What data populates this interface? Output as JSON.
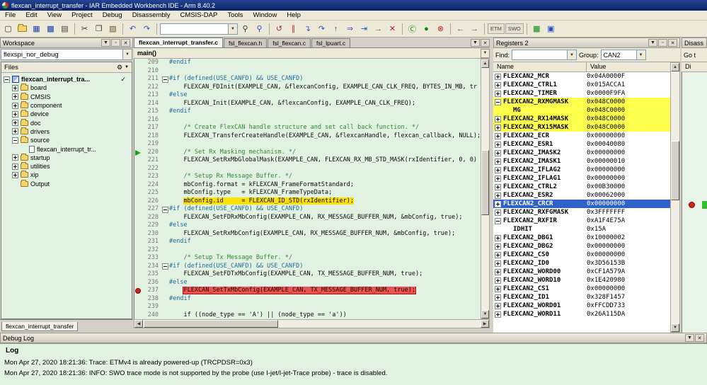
{
  "window": {
    "title": "flexcan_interrupt_transfer - IAR Embedded Workbench IDE - Arm 8.40.2"
  },
  "glyphs": {
    "menu_btn": "▼",
    "pin_btn": "▫",
    "close_btn": "✕",
    "dropdown": "▼",
    "up": "▲",
    "down": "▼",
    "left": "◀",
    "right": "▶",
    "gear": "⚙",
    "check": "✓"
  },
  "menu": {
    "items": [
      "File",
      "Edit",
      "View",
      "Project",
      "Debug",
      "Disassembly",
      "CMSIS-DAP",
      "Tools",
      "Window",
      "Help"
    ]
  },
  "toolbar": {
    "items": [
      {
        "type": "icon",
        "name": "new-document-icon",
        "glyph": "▢",
        "color": "#303030"
      },
      {
        "type": "folder",
        "name": "open-file-icon"
      },
      {
        "type": "icon",
        "name": "save-icon",
        "glyph": "▦",
        "color": "#1c3faa"
      },
      {
        "type": "icon",
        "name": "save-all-icon",
        "glyph": "▩",
        "color": "#1c3faa"
      },
      {
        "type": "icon",
        "name": "print-icon",
        "glyph": "▤",
        "color": "#404040"
      },
      {
        "type": "sep"
      },
      {
        "type": "icon",
        "name": "cut-icon",
        "glyph": "✂",
        "color": "#303030"
      },
      {
        "type": "icon",
        "name": "copy-icon",
        "glyph": "❐",
        "color": "#303030"
      },
      {
        "type": "icon",
        "name": "paste-icon",
        "glyph": "▨",
        "color": "#705020"
      },
      {
        "type": "sep"
      },
      {
        "type": "icon",
        "name": "undo-icon",
        "glyph": "↶",
        "color": "#2a4fbf"
      },
      {
        "type": "icon",
        "name": "redo-icon",
        "glyph": "↷",
        "color": "#2a4fbf"
      },
      {
        "type": "sep"
      },
      {
        "type": "combo",
        "name": "quick-search-combo"
      },
      {
        "type": "icon",
        "name": "find-icon",
        "glyph": "⚲",
        "color": "#303030"
      },
      {
        "type": "icon",
        "name": "find-next-icon",
        "glyph": "⚲",
        "color": "#2a4fbf"
      },
      {
        "type": "sep"
      },
      {
        "type": "icon",
        "name": "reset-icon",
        "glyph": "↺",
        "color": "#a03030"
      },
      {
        "type": "icon",
        "name": "break-icon",
        "glyph": "∥",
        "color": "#a03030"
      },
      {
        "type": "icon",
        "name": "step-into-icon",
        "glyph": "↴",
        "color": "#2a4fbf"
      },
      {
        "type": "icon",
        "name": "step-over-icon",
        "glyph": "↷",
        "color": "#2a4fbf"
      },
      {
        "type": "icon",
        "name": "step-out-icon",
        "glyph": "↑",
        "color": "#2a4fbf"
      },
      {
        "type": "icon",
        "name": "next-statement-icon",
        "glyph": "⇒",
        "color": "#2a4fbf"
      },
      {
        "type": "icon",
        "name": "run-to-cursor-icon",
        "glyph": "⇥",
        "color": "#2a4fbf"
      },
      {
        "type": "icon",
        "name": "go-icon",
        "glyph": "→",
        "color": "#0a8a0a"
      },
      {
        "type": "icon",
        "name": "stop-debug-icon",
        "glyph": "✕",
        "color": "#c02020"
      },
      {
        "type": "sep"
      },
      {
        "type": "icon",
        "name": "probe-connect-icon",
        "glyph": "Ⓒ",
        "color": "#0a8a0a"
      },
      {
        "type": "icon",
        "name": "probe-active-icon",
        "glyph": "●",
        "color": "#0a8a0a"
      },
      {
        "type": "icon",
        "name": "probe-disconnect-icon",
        "glyph": "⊗",
        "color": "#c02020"
      },
      {
        "type": "sep"
      },
      {
        "type": "icon",
        "name": "nav-back-icon",
        "glyph": "←",
        "color": "#2a4fbf"
      },
      {
        "type": "icon",
        "name": "nav-forward-icon",
        "glyph": "→",
        "color": "#2a4fbf"
      },
      {
        "type": "sep"
      },
      {
        "type": "text",
        "name": "etm-button",
        "label": "ETM"
      },
      {
        "type": "text",
        "name": "swo-button",
        "label": "SWO"
      },
      {
        "type": "sep"
      },
      {
        "type": "icon",
        "name": "trace-icon",
        "glyph": "▦",
        "color": "#0a8a0a"
      },
      {
        "type": "icon",
        "name": "terminal-io-icon",
        "glyph": "▣",
        "color": "#2a4fbf"
      }
    ]
  },
  "workspace": {
    "title": "Workspace",
    "config": "flexspi_nor_debug",
    "files_header": "Files",
    "bottom_tab": "flexcan_interrupt_transfer",
    "tree": [
      {
        "label": "flexcan_interrupt_tra...",
        "level": 0,
        "icon": "project",
        "exp": "minus",
        "bold": true,
        "check": true
      },
      {
        "label": "board",
        "level": 1,
        "icon": "folder",
        "exp": "plus"
      },
      {
        "label": "CMSIS",
        "level": 1,
        "icon": "folder",
        "exp": "plus"
      },
      {
        "label": "component",
        "level": 1,
        "icon": "folder",
        "exp": "plus"
      },
      {
        "label": "device",
        "level": 1,
        "icon": "folder",
        "exp": "plus"
      },
      {
        "label": "doc",
        "level": 1,
        "icon": "folder",
        "exp": "plus"
      },
      {
        "label": "drivers",
        "level": 1,
        "icon": "folder",
        "exp": "plus"
      },
      {
        "label": "source",
        "level": 1,
        "icon": "folder",
        "exp": "minus"
      },
      {
        "label": "flexcan_interrupt_tr...",
        "level": 2,
        "icon": "file",
        "exp": null
      },
      {
        "label": "startup",
        "level": 1,
        "icon": "folder",
        "exp": "plus"
      },
      {
        "label": "utilities",
        "level": 1,
        "icon": "folder",
        "exp": "plus"
      },
      {
        "label": "xip",
        "level": 1,
        "icon": "folder",
        "exp": "plus"
      },
      {
        "label": "Output",
        "level": 1,
        "icon": "folder",
        "exp": null
      }
    ]
  },
  "editor": {
    "scope": "main()",
    "tabs": [
      {
        "label": "flexcan_interrupt_transfer.c",
        "active": true
      },
      {
        "label": "fsl_flexcan.h",
        "active": false
      },
      {
        "label": "fsl_flexcan.c",
        "active": false
      },
      {
        "label": "fsl_lpuart.c",
        "active": false
      }
    ],
    "lines": [
      {
        "n": 209,
        "s": [
          [
            "pp",
            "#endif"
          ]
        ]
      },
      {
        "n": 210,
        "s": []
      },
      {
        "n": 211,
        "fold": true,
        "s": [
          [
            "pp",
            "#if (defined(USE_CANFD) && USE_CANFD)"
          ]
        ]
      },
      {
        "n": 212,
        "s": [
          [
            "c",
            "    FLEXCAN_FDInit(EXAMPLE_CAN, &flexcanConfig, EXAMPLE_CAN_CLK_FREQ, BYTES_IN_MB, tr"
          ]
        ]
      },
      {
        "n": 213,
        "s": [
          [
            "pp",
            "#else"
          ]
        ]
      },
      {
        "n": 214,
        "s": [
          [
            "c",
            "    FLEXCAN_Init(EXAMPLE_CAN, &flexcanConfig, EXAMPLE_CAN_CLK_FREQ);"
          ]
        ]
      },
      {
        "n": 215,
        "s": [
          [
            "pp",
            "#endif"
          ]
        ]
      },
      {
        "n": 216,
        "s": []
      },
      {
        "n": 217,
        "s": [
          [
            "cm",
            "    /* Create FlexCAN handle structure and set call back function. */"
          ]
        ]
      },
      {
        "n": 218,
        "s": [
          [
            "c",
            "    FLEXCAN_TransferCreateHandle(EXAMPLE_CAN, &flexcanHandle, flexcan_callback, NULL);"
          ]
        ]
      },
      {
        "n": 219,
        "s": []
      },
      {
        "n": 220,
        "mark": "arrow",
        "s": [
          [
            "cm",
            "    /* Set Rx Masking mechanism. */"
          ]
        ]
      },
      {
        "n": 221,
        "s": [
          [
            "c",
            "    FLEXCAN_SetRxMbGlobalMask(EXAMPLE_CAN, FLEXCAN_RX_MB_STD_MASK(rxIdentifier, 0, 0)"
          ]
        ]
      },
      {
        "n": 222,
        "s": []
      },
      {
        "n": 223,
        "s": [
          [
            "cm",
            "    /* Setup Rx Message Buffer. */"
          ]
        ]
      },
      {
        "n": 224,
        "s": [
          [
            "c",
            "    mbConfig.format = kFLEXCAN_FrameFormatStandard;"
          ]
        ]
      },
      {
        "n": 225,
        "s": [
          [
            "c",
            "    mbConfig.type   = kFLEXCAN_FrameTypeData;"
          ]
        ]
      },
      {
        "n": 226,
        "s": [
          [
            "c",
            "    "
          ],
          [
            "hy",
            "mbConfig.id     = FLEXCAN_ID_STD(rxIdentifier);"
          ]
        ]
      },
      {
        "n": 227,
        "fold": true,
        "s": [
          [
            "pp",
            "#if (defined(USE_CANFD) && USE_CANFD)"
          ]
        ]
      },
      {
        "n": 228,
        "s": [
          [
            "c",
            "    FLEXCAN_SetFDRxMbConfig(EXAMPLE_CAN, RX_MESSAGE_BUFFER_NUM, &mbConfig, true);"
          ]
        ]
      },
      {
        "n": 229,
        "s": [
          [
            "pp",
            "#else"
          ]
        ]
      },
      {
        "n": 230,
        "s": [
          [
            "c",
            "    FLEXCAN_SetRxMbConfig(EXAMPLE_CAN, RX_MESSAGE_BUFFER_NUM, &mbConfig, true);"
          ]
        ]
      },
      {
        "n": 231,
        "s": [
          [
            "pp",
            "#endif"
          ]
        ]
      },
      {
        "n": 232,
        "s": []
      },
      {
        "n": 233,
        "s": [
          [
            "cm",
            "    /* Setup Tx Message Buffer. */"
          ]
        ]
      },
      {
        "n": 234,
        "fold": true,
        "s": [
          [
            "pp",
            "#if (defined(USE_CANFD) && USE_CANFD)"
          ]
        ]
      },
      {
        "n": 235,
        "s": [
          [
            "c",
            "    FLEXCAN_SetFDTxMbConfig(EXAMPLE_CAN, TX_MESSAGE_BUFFER_NUM, true);"
          ]
        ]
      },
      {
        "n": 236,
        "s": [
          [
            "pp",
            "#else"
          ]
        ]
      },
      {
        "n": 237,
        "mark": "bp",
        "s": [
          [
            "c",
            "    "
          ],
          [
            "hr",
            "FLEXCAN_SetTxMbConfig(EXAMPLE_CAN, TX_MESSAGE_BUFFER_NUM, true);"
          ]
        ]
      },
      {
        "n": 238,
        "s": [
          [
            "pp",
            "#endif"
          ]
        ]
      },
      {
        "n": 239,
        "s": []
      },
      {
        "n": 240,
        "s": [
          [
            "c",
            "    if ((node_type == 'A') || (node_type == 'a'))"
          ]
        ]
      }
    ]
  },
  "registers": {
    "title": "Registers 2",
    "find_label": "Find:",
    "group_label": "Group:",
    "group_value": "CAN2",
    "columns": [
      "Name",
      "Value"
    ],
    "rows": [
      {
        "name": "FLEXCAN2_MCR",
        "value": "0x04A0000F",
        "level": 0,
        "exp": "plus"
      },
      {
        "name": "FLEXCAN2_CTRL1",
        "value": "0x015ACCA1",
        "level": 0,
        "exp": "plus"
      },
      {
        "name": "FLEXCAN2_TIMER",
        "value": "0x0000F9FA",
        "level": 0,
        "exp": "plus"
      },
      {
        "name": "FLEXCAN2_RXMGMASK",
        "value": "0x048C0000",
        "level": 0,
        "exp": "minus",
        "hl": "y"
      },
      {
        "name": "MG",
        "value": "0x048C0000",
        "level": 1,
        "exp": null,
        "hl": "y"
      },
      {
        "name": "FLEXCAN2_RX14MASK",
        "value": "0x048C0000",
        "level": 0,
        "exp": "plus",
        "hl": "y"
      },
      {
        "name": "FLEXCAN2_RX15MASK",
        "value": "0x048C0000",
        "level": 0,
        "exp": "plus",
        "hl": "y"
      },
      {
        "name": "FLEXCAN2_ECR",
        "value": "0x00000000",
        "level": 0,
        "exp": "plus"
      },
      {
        "name": "FLEXCAN2_ESR1",
        "value": "0x00040080",
        "level": 0,
        "exp": "plus"
      },
      {
        "name": "FLEXCAN2_IMASK2",
        "value": "0x00000000",
        "level": 0,
        "exp": "plus"
      },
      {
        "name": "FLEXCAN2_IMASK1",
        "value": "0x00000010",
        "level": 0,
        "exp": "plus"
      },
      {
        "name": "FLEXCAN2_IFLAG2",
        "value": "0x00000000",
        "level": 0,
        "exp": "plus"
      },
      {
        "name": "FLEXCAN2_IFLAG1",
        "value": "0x00000000",
        "level": 0,
        "exp": "plus"
      },
      {
        "name": "FLEXCAN2_CTRL2",
        "value": "0x00B30000",
        "level": 0,
        "exp": "plus"
      },
      {
        "name": "FLEXCAN2_ESR2",
        "value": "0x00062000",
        "level": 0,
        "exp": "plus"
      },
      {
        "name": "FLEXCAN2_CRCR",
        "value": "0x00000000",
        "level": 0,
        "exp": "plus",
        "hl": "sel"
      },
      {
        "name": "FLEXCAN2_RXFGMASK",
        "value": "0x3FFFFFFF",
        "level": 0,
        "exp": "plus"
      },
      {
        "name": "FLEXCAN2_RXFIR",
        "value": "0xA1F4E75A",
        "level": 0,
        "exp": "minus"
      },
      {
        "name": "IDHIT",
        "value": "0x15A",
        "level": 1,
        "exp": null
      },
      {
        "name": "FLEXCAN2_DBG1",
        "value": "0x10000002",
        "level": 0,
        "exp": "plus"
      },
      {
        "name": "FLEXCAN2_DBG2",
        "value": "0x00000000",
        "level": 0,
        "exp": "plus"
      },
      {
        "name": "FLEXCAN2_CS0",
        "value": "0x00000000",
        "level": 0,
        "exp": "plus"
      },
      {
        "name": "FLEXCAN2_ID0",
        "value": "0x3D56153B",
        "level": 0,
        "exp": "plus"
      },
      {
        "name": "FLEXCAN2_WORD00",
        "value": "0xCF1A579A",
        "level": 0,
        "exp": "plus"
      },
      {
        "name": "FLEXCAN2_WORD10",
        "value": "0x1E420980",
        "level": 0,
        "exp": "plus"
      },
      {
        "name": "FLEXCAN2_CS1",
        "value": "0x00000000",
        "level": 0,
        "exp": "plus"
      },
      {
        "name": "FLEXCAN2_ID1",
        "value": "0x328F1457",
        "level": 0,
        "exp": "plus"
      },
      {
        "name": "FLEXCAN2_WORD01",
        "value": "0xFFCDD733",
        "level": 0,
        "exp": "plus"
      },
      {
        "name": "FLEXCAN2_WORD11",
        "value": "0x26A115DA",
        "level": 0,
        "exp": "plus"
      }
    ]
  },
  "disassembly": {
    "title": "Disass",
    "goto_label": "Go t",
    "col_label": "Di"
  },
  "debug_log": {
    "title": "Debug Log",
    "header": "Log",
    "entries": [
      "Mon Apr 27, 2020 18:21:36: Trace: ETMv4 is already powered-up (TRCPDSR=0x3)",
      "Mon Apr 27, 2020 18:21:36: INFO: SWO trace mode is not supported by the probe (use I-jet/I-jet-Trace probe) - trace is disabled."
    ]
  }
}
